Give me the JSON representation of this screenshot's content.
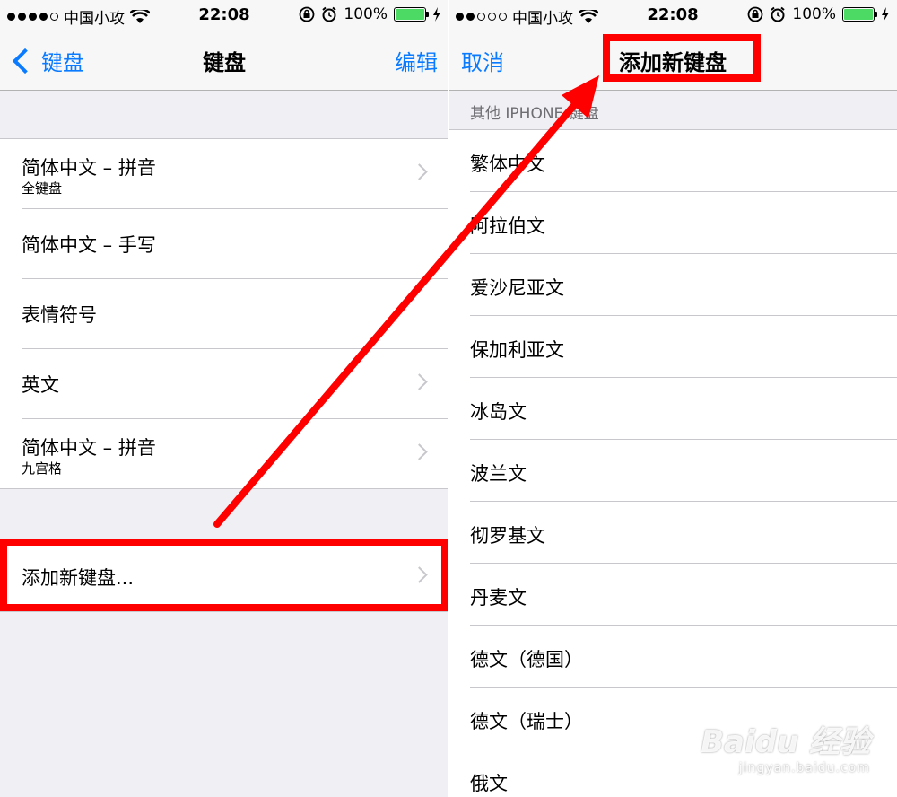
{
  "status_bar": {
    "carrier": "中国小攻",
    "time": "22:08",
    "battery": "100%",
    "battery_color": "#4cd964"
  },
  "left_screen": {
    "nav": {
      "back_label": "键盘",
      "title": "键盘",
      "edit_label": "编辑"
    },
    "keyboards": [
      {
        "label": "简体中文 – 拼音",
        "sub": "全键盘"
      },
      {
        "label": "简体中文 – 手写"
      },
      {
        "label": "表情符号"
      },
      {
        "label": "英文"
      },
      {
        "label": "简体中文 – 拼音",
        "sub": "九宫格"
      }
    ],
    "add_keyboard_label": "添加新键盘..."
  },
  "right_screen": {
    "nav": {
      "cancel_label": "取消",
      "title": "添加新键盘"
    },
    "section_header": "其他 IPHONE 键盘",
    "languages": [
      "繁体中文",
      "阿拉伯文",
      "爱沙尼亚文",
      "保加利亚文",
      "冰岛文",
      "波兰文",
      "彻罗基文",
      "丹麦文",
      "德文（德国）",
      "德文（瑞士）",
      "俄文"
    ]
  },
  "annotation": {
    "color": "#ff0000"
  },
  "watermark": {
    "logo": "Baidu 经验",
    "url": "jingyan.baidu.com"
  },
  "icons": [
    "wifi-icon",
    "orientation-lock-icon",
    "alarm-icon",
    "charging-icon",
    "back-chevron-icon",
    "disclosure-chevron-icon",
    "annotation-arrow"
  ]
}
